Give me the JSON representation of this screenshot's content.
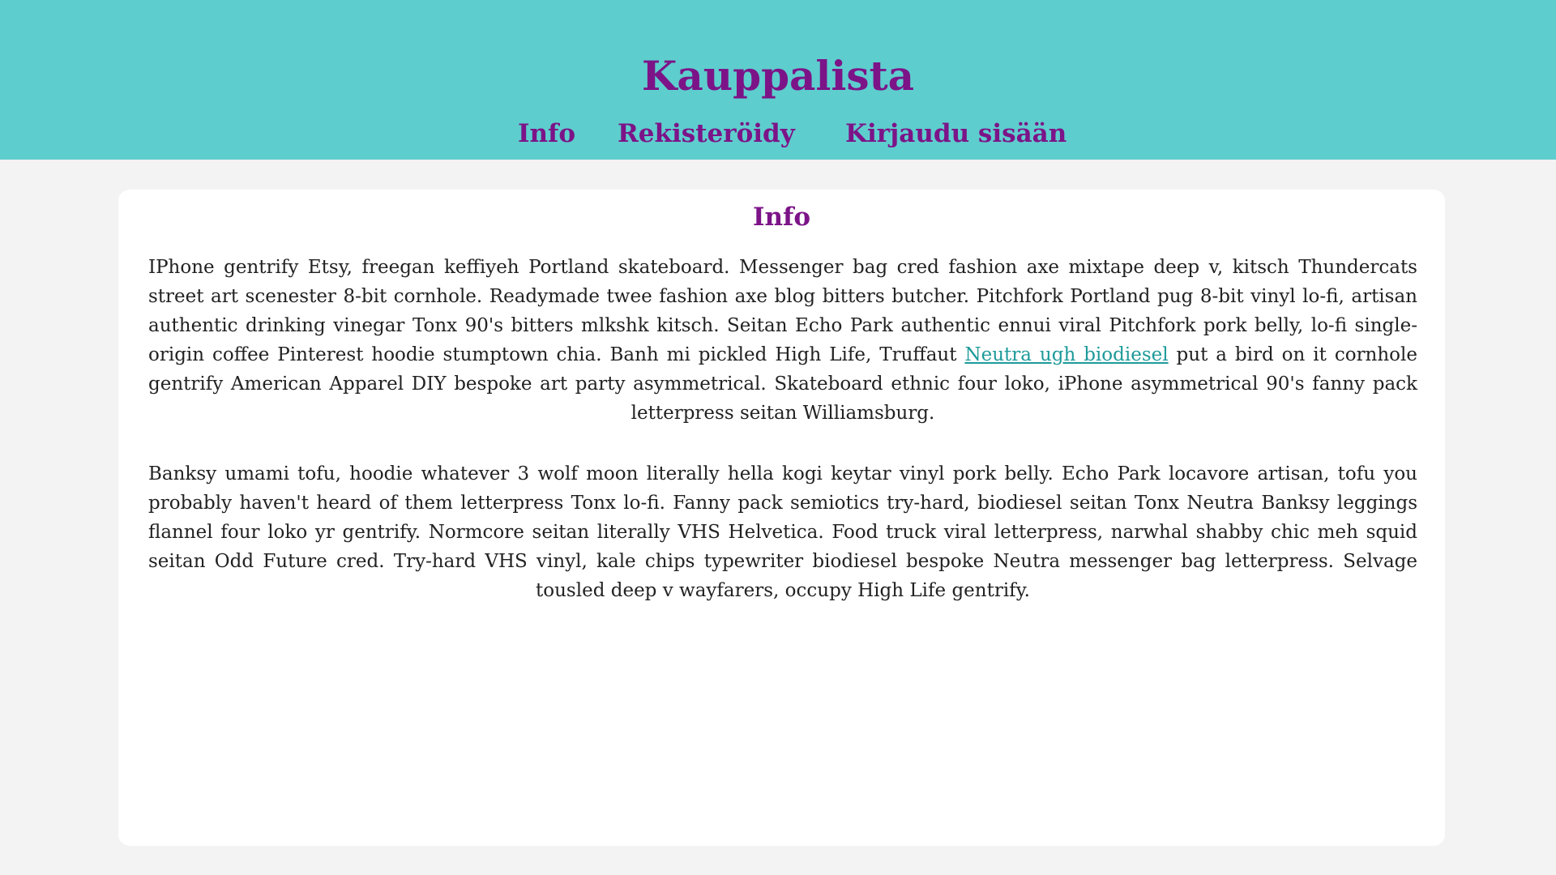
{
  "header": {
    "title": "Kauppalista",
    "nav": {
      "info": "Info",
      "register": "Rekisteröidy",
      "login": "Kirjaudu sisään"
    }
  },
  "main": {
    "heading": "Info",
    "paragraph1": {
      "before_link": "IPhone gentrify Etsy, freegan keffiyeh Portland skateboard. Messenger bag cred fashion axe mixtape deep v, kitsch Thundercats street art scenester 8-bit cornhole. Readymade twee fashion axe blog bitters butcher. Pitchfork Portland pug 8-bit vinyl lo-fi, artisan authentic drinking vinegar Tonx 90's bitters mlkshk kitsch. Seitan Echo Park authentic ennui viral Pitchfork pork belly, lo-fi single-origin coffee Pinterest hoodie stumptown chia. Banh mi pickled High Life, Truffaut ",
      "link": "Neutra ugh biodiesel",
      "after_link": " put a bird on it cornhole gentrify American Apparel DIY bespoke art party asymmetrical. Skateboard ethnic four loko, iPhone asymmetrical 90's fanny pack letterpress seitan Williamsburg."
    },
    "paragraph2": "Banksy umami tofu, hoodie whatever 3 wolf moon literally hella kogi keytar vinyl pork belly. Echo Park locavore artisan, tofu you probably haven't heard of them letterpress Tonx lo-fi. Fanny pack semiotics try-hard, biodiesel seitan Tonx Neutra Banksy leggings flannel four loko yr gentrify. Normcore seitan literally VHS Helvetica. Food truck viral letterpress, narwhal shabby chic meh squid seitan Odd Future cred. Try-hard VHS vinyl, kale chips typewriter biodiesel bespoke Neutra messenger bag letterpress. Selvage tousled deep v wayfarers, occupy High Life gentrify."
  },
  "colors": {
    "header_bg": "#5ecdcd",
    "accent": "#7c1488",
    "link": "#1e9a9a",
    "page_bg": "#f3f3f3"
  }
}
